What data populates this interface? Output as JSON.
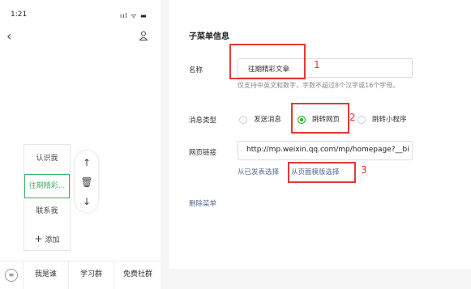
{
  "status": {
    "time": "1:21",
    "signal": "ııl ᯤ ▬"
  },
  "phone": {
    "menu_items": [
      "认识我",
      "往期精彩...",
      "联系我"
    ],
    "add_label": "添加",
    "tool_icons": [
      "arrow-up-icon",
      "trash-icon",
      "arrow-down-icon"
    ],
    "tabs": [
      "我是谁",
      "学习群",
      "免费社群"
    ]
  },
  "panel": {
    "title": "子菜单信息",
    "name_label": "名称",
    "name_value": "往期精彩文章",
    "hint": "仅支持中英文和数字，字数不超过8个汉字或16个字母。",
    "type_label": "消息类型",
    "options": [
      "发送消息",
      "跳转网页",
      "跳转小程序"
    ],
    "selected_option": "跳转网页",
    "url_label": "网页链接",
    "url_value": "http://mp.weixin.qq.com/mp/homepage?__bi",
    "link_published": "从已发表选择",
    "link_template": "从页面模版选择",
    "delete_label": "删除菜单"
  },
  "annotations": [
    "1",
    "2",
    "3"
  ],
  "colors": {
    "accent": "#1aad19",
    "annotation": "#e53935",
    "link": "#576b95"
  }
}
